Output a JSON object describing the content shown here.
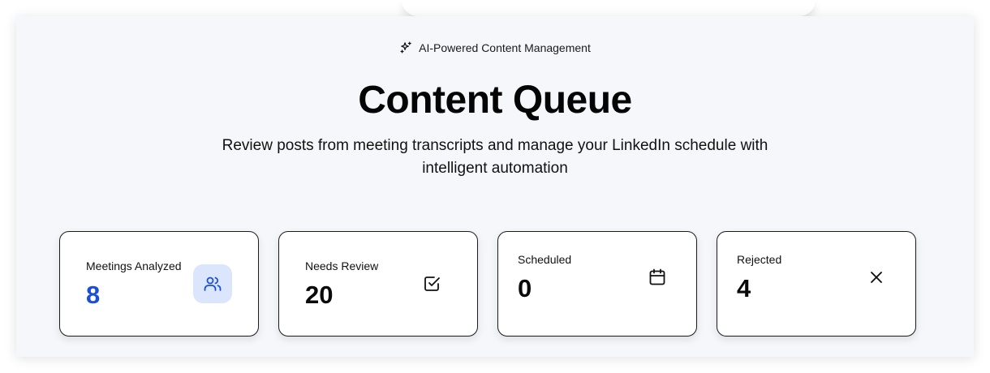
{
  "header": {
    "badge_text": "AI-Powered Content Management",
    "title": "Content Queue",
    "subtitle": "Review posts from meeting transcripts and manage your LinkedIn schedule with intelligent automation"
  },
  "stats": [
    {
      "label": "Meetings Analyzed",
      "value": "8",
      "icon": "users-icon",
      "accent": "#1d4ed8",
      "icon_bg": "#dbe6fd"
    },
    {
      "label": "Needs Review",
      "value": "20",
      "icon": "check-square-icon"
    },
    {
      "label": "Scheduled",
      "value": "0",
      "icon": "calendar-icon"
    },
    {
      "label": "Rejected",
      "value": "4",
      "icon": "x-icon"
    }
  ]
}
